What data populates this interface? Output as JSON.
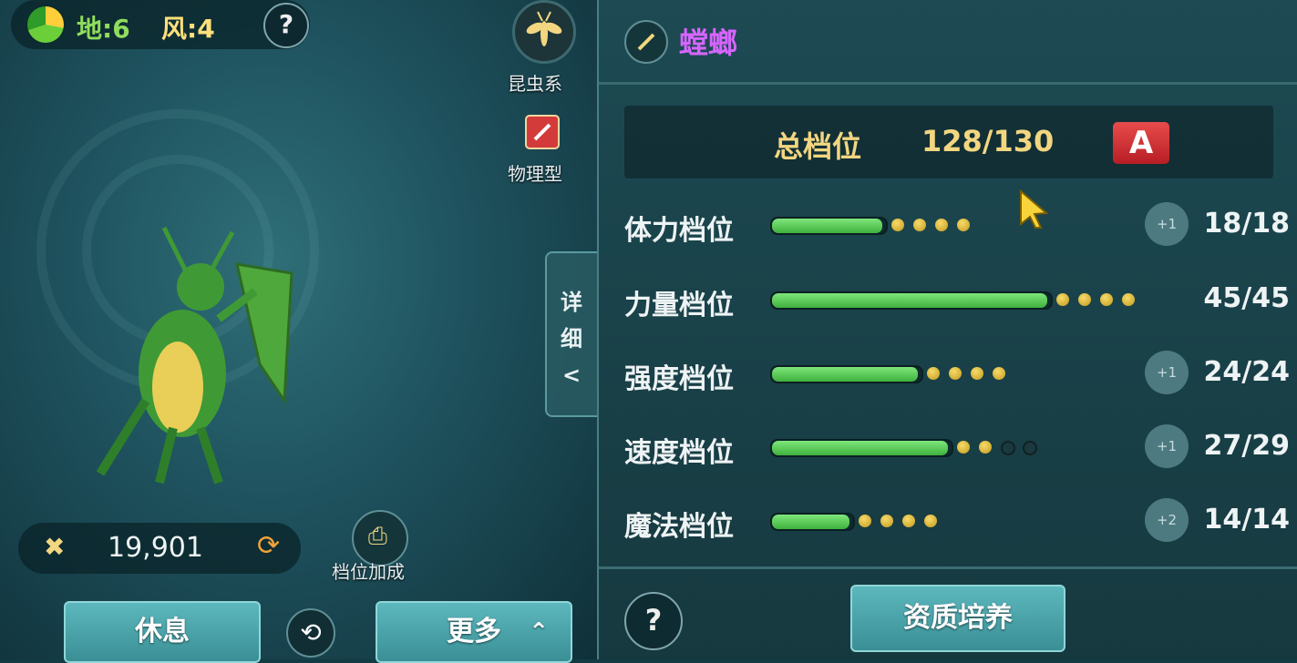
{
  "left": {
    "element_earth": "地:6",
    "element_wind": "风:4",
    "help_label": "?",
    "type_label": "昆虫系",
    "attack_type_label": "物理型",
    "power_value": "19,901",
    "bonus_label": "档位加成",
    "detail_tab": [
      "详",
      "细",
      "<"
    ],
    "rest_button": "休息",
    "more_button": "更多"
  },
  "right": {
    "pet_name": "螳螂",
    "total": {
      "label": "总档位",
      "value": "128/130",
      "grade": "A"
    },
    "stats": [
      {
        "label": "体力档位",
        "fill": 0.4,
        "dots": [
          1,
          1,
          1,
          1
        ],
        "plus": "+1",
        "value": "18/18"
      },
      {
        "label": "力量档位",
        "fill": 1.0,
        "dots": [
          1,
          1,
          1,
          1
        ],
        "plus": "",
        "value": "45/45"
      },
      {
        "label": "强度档位",
        "fill": 0.53,
        "dots": [
          1,
          1,
          1,
          1
        ],
        "plus": "+1",
        "value": "24/24"
      },
      {
        "label": "速度档位",
        "fill": 0.64,
        "dots": [
          1,
          1,
          0,
          0
        ],
        "plus": "+1",
        "value": "27/29"
      },
      {
        "label": "魔法档位",
        "fill": 0.28,
        "dots": [
          1,
          1,
          1,
          1
        ],
        "plus": "+2",
        "value": "14/14"
      }
    ],
    "help_label": "?",
    "train_button": "资质培养"
  },
  "colors": {
    "name": "#d765ff",
    "gold": "#f2d680",
    "grade_red": "#d0343a",
    "bar_green": "#4fc24d"
  }
}
